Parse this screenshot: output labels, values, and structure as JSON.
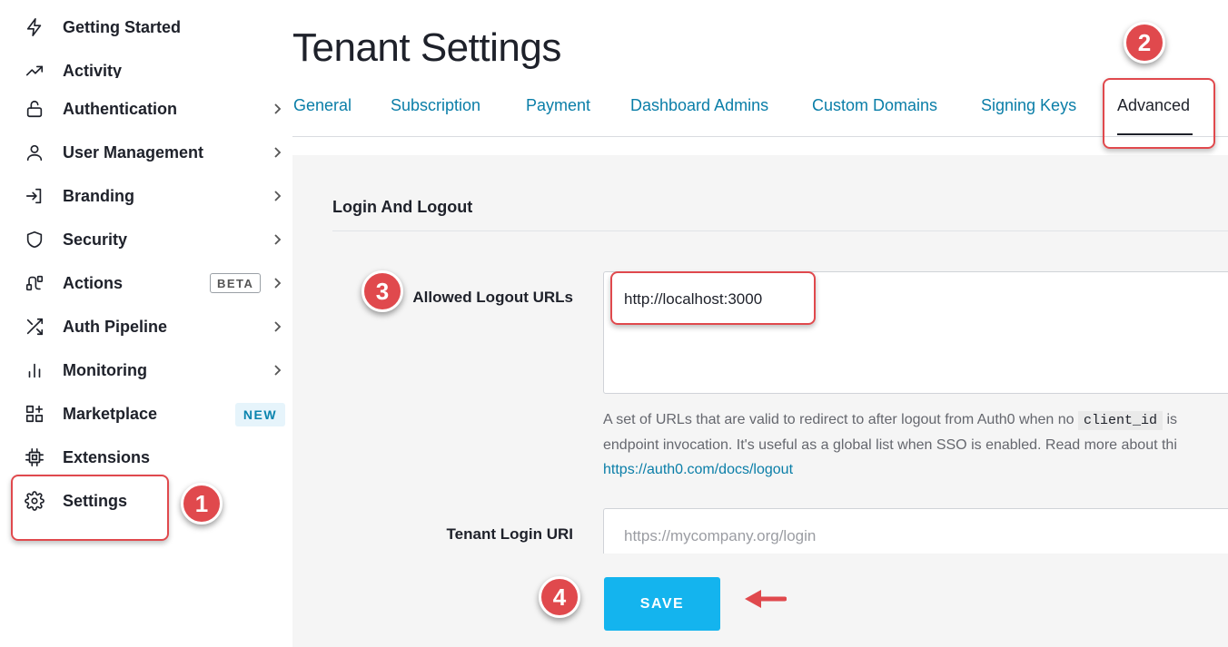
{
  "sidebar": {
    "items": [
      {
        "label": "Getting Started",
        "icon": "lightning-icon",
        "chevron": false
      },
      {
        "label": "Activity",
        "icon": "trending-up-icon",
        "chevron": false
      },
      {
        "label": "Authentication",
        "icon": "lock-icon",
        "chevron": true
      },
      {
        "label": "User Management",
        "icon": "user-icon",
        "chevron": true
      },
      {
        "label": "Branding",
        "icon": "login-arrow-icon",
        "chevron": true
      },
      {
        "label": "Security",
        "icon": "shield-icon",
        "chevron": true
      },
      {
        "label": "Actions",
        "icon": "actions-flow-icon",
        "chevron": true,
        "badge": "BETA"
      },
      {
        "label": "Auth Pipeline",
        "icon": "shuffle-icon",
        "chevron": true
      },
      {
        "label": "Monitoring",
        "icon": "bar-chart-icon",
        "chevron": true
      },
      {
        "label": "Marketplace",
        "icon": "grid-plus-icon",
        "chevron": false,
        "badge": "NEW"
      },
      {
        "label": "Extensions",
        "icon": "chip-icon",
        "chevron": false
      },
      {
        "label": "Settings",
        "icon": "gear-icon",
        "chevron": false,
        "selected": true
      }
    ]
  },
  "page": {
    "title": "Tenant Settings"
  },
  "tabs": [
    {
      "label": "General"
    },
    {
      "label": "Subscription"
    },
    {
      "label": "Payment"
    },
    {
      "label": "Dashboard Admins"
    },
    {
      "label": "Custom Domains"
    },
    {
      "label": "Signing Keys"
    },
    {
      "label": "Advanced",
      "active": true
    }
  ],
  "section": {
    "title": "Login And Logout"
  },
  "logout_urls": {
    "label": "Allowed Logout URLs",
    "value": "http://localhost:3000",
    "help_prefix": "A set of URLs that are valid to redirect to after logout from Auth0 when no",
    "help_code": "client_id",
    "help_middle": "is",
    "help_line2": "endpoint invocation. It's useful as a global list when SSO is enabled. Read more about thi",
    "help_link": "https://auth0.com/docs/logout"
  },
  "login_uri": {
    "label": "Tenant Login URI",
    "placeholder": "https://mycompany.org/login"
  },
  "actions": {
    "save_label": "SAVE"
  },
  "annotations": {
    "markers": [
      "1",
      "2",
      "3",
      "4"
    ],
    "color": "#e0494d"
  },
  "colors": {
    "link": "#0a7ea8",
    "save_button": "#14b4ee",
    "content_bg": "#f5f5f5"
  }
}
